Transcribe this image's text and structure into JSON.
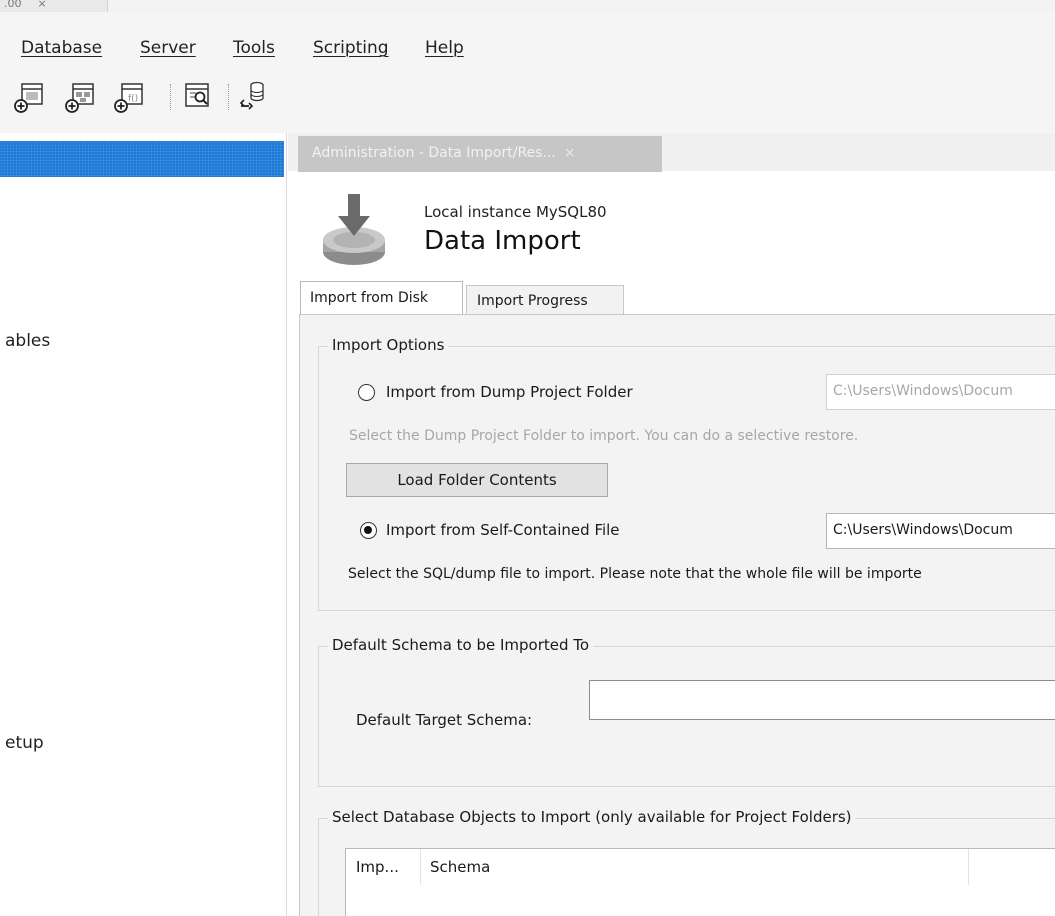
{
  "window_tab": {
    "label": ".00",
    "close": "×"
  },
  "menu": [
    "Database",
    "Server",
    "Tools",
    "Scripting",
    "Help"
  ],
  "toolbar_icons": [
    "new-sql-tab-icon",
    "open-sql-script-icon",
    "create-function-icon",
    "inspect-object-icon",
    "reconnect-database-icon"
  ],
  "navigator": {
    "items": [
      "ables",
      "etup"
    ]
  },
  "doc_tab": {
    "label": "Administration - Data Import/Res...",
    "close": "×"
  },
  "header": {
    "instance": "Local instance MySQL80",
    "title": "Data Import"
  },
  "tabs": [
    "Import from Disk",
    "Import Progress"
  ],
  "import_options": {
    "legend": "Import Options",
    "dump_folder": {
      "label": "Import from Dump Project Folder",
      "path": "C:\\Users\\Windows\\Docum",
      "hint": "Select the Dump Project Folder to import. You can do a selective restore.",
      "selected": false
    },
    "load_button": "Load Folder Contents",
    "self_contained": {
      "label": "Import from Self-Contained File",
      "path": "C:\\Users\\Windows\\Docum",
      "hint": "Select the SQL/dump file to import. Please note that the whole file will be importe",
      "selected": true
    }
  },
  "default_schema": {
    "legend": "Default Schema to be Imported To",
    "target_label": "Default Target Schema:",
    "target_value": ""
  },
  "objects": {
    "legend": "Select Database Objects to Import (only available for Project Folders)",
    "columns": [
      "Imp...",
      "Schema"
    ]
  },
  "colors": {
    "accent": "#1e7ad6",
    "panel": "#f3f3f3",
    "doc_tab": "#c6c6c6",
    "disabled_text": "#a7a7a7"
  }
}
